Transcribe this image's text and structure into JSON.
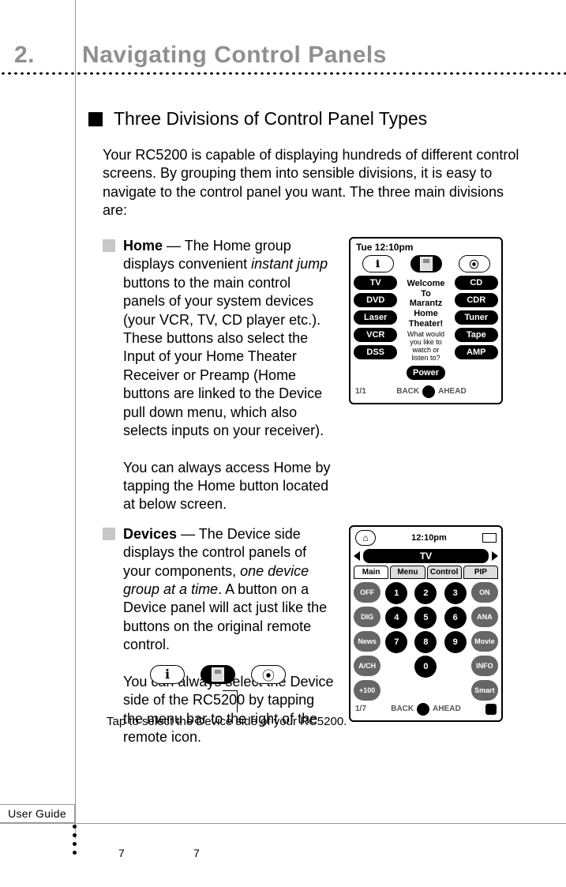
{
  "chapter": {
    "num": "2.",
    "title": "Navigating Control Panels"
  },
  "section": {
    "title": "Three Divisions of Control Panel Types"
  },
  "intro": "Your RC5200 is capable of displaying hundreds of different control screens. By grouping them into sensible divisions, it is easy to navigate to the control panel you want. The three main divisions are:",
  "items": {
    "home": {
      "label": "Home",
      "dash": "  — ",
      "p1a": "The Home group displays convenient ",
      "em1": "instant jump",
      "p1b": " buttons to the main control panels of your system devices (your VCR, TV, CD player etc.). These buttons also select the Input of your Home Theater Receiver or Preamp (Home buttons are linked to the Device pull down menu, which also selects inputs on your receiver).",
      "p2": "You can always access Home by tapping the Home button located at below screen."
    },
    "devices": {
      "label": "Devices",
      "dash": " — ",
      "p1a": "The Device side displays the control panels of your components, ",
      "em1": "one device group at a time",
      "p1b": ".  A button on a Device panel will act just like the buttons on the original remote control.",
      "p2": "You can always select the Device side of the RC5200  by tapping the menu bar to the right of the remote icon."
    }
  },
  "caption": "Tap to select the Device side of your RC5200.",
  "footer": {
    "tab": "User Guide",
    "page1": "7",
    "page2": "7"
  },
  "home_screen": {
    "time": "Tue 12:10pm",
    "welcome_l1": "Welcome",
    "welcome_l2": "To",
    "welcome_l3": "Marantz",
    "welcome_l4": "Home",
    "welcome_l5": "Theater!",
    "welcome_sub": "What would you like to watch or listen to?",
    "buttons": [
      "TV",
      "CD",
      "DVD",
      "CDR",
      "Laser",
      "Tuner",
      "VCR",
      "Tape",
      "DSS",
      "Power",
      "AMP"
    ],
    "foot_page": "1/1",
    "foot_back": "BACK",
    "foot_ahead": "AHEAD"
  },
  "device_screen": {
    "time": "12:10pm",
    "device": "TV",
    "tabs": [
      "Main",
      "Menu",
      "Control",
      "PIP"
    ],
    "row1": [
      "OFF",
      "1",
      "2",
      "3",
      "ON"
    ],
    "row2": [
      "DIG",
      "4",
      "5",
      "6",
      "ANA"
    ],
    "row3": [
      "News",
      "7",
      "8",
      "9",
      "Movie"
    ],
    "row4": [
      "A/CH",
      "",
      "0",
      "",
      "INFO"
    ],
    "row5": [
      "+100",
      "",
      "",
      "",
      "Smart"
    ],
    "foot_page": "1/7",
    "foot_back": "BACK",
    "foot_ahead": "AHEAD"
  }
}
